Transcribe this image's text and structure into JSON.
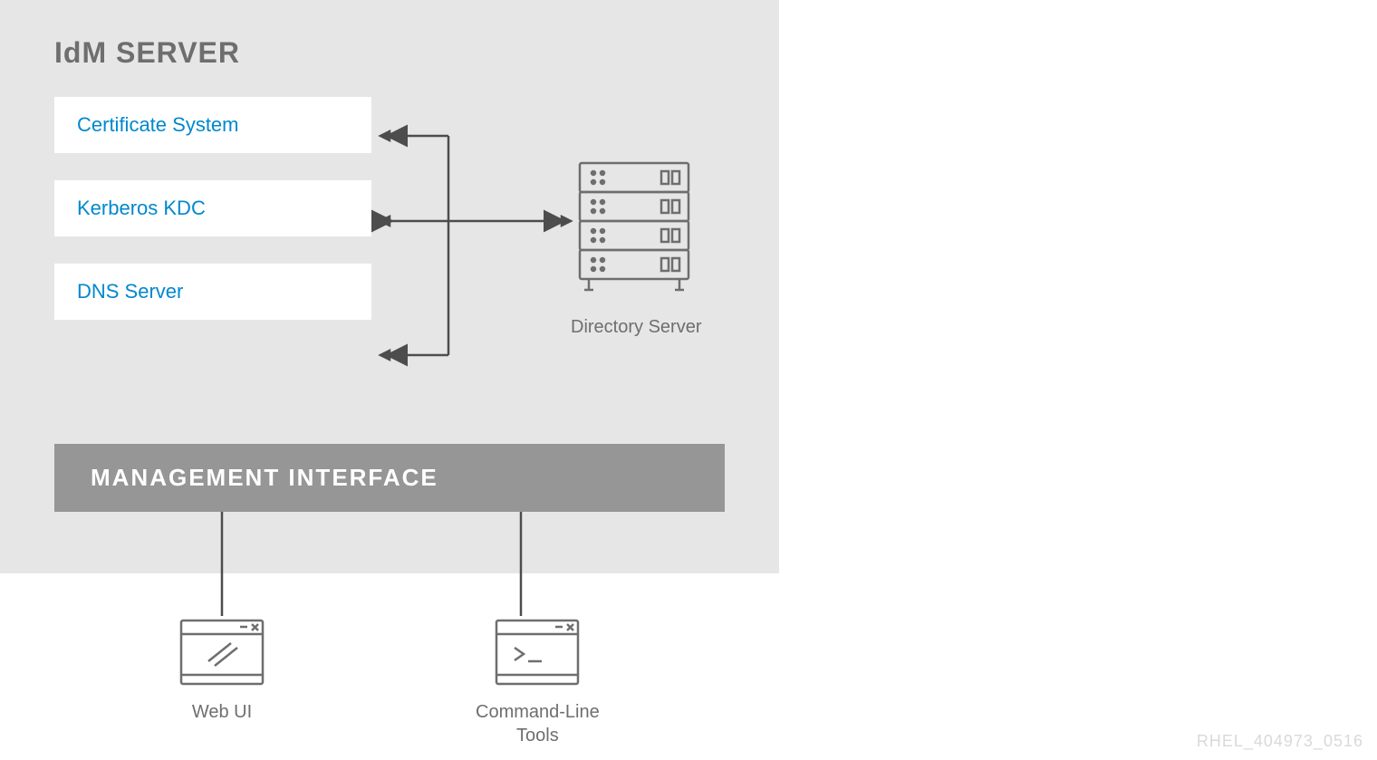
{
  "server": {
    "title": "IdM SERVER",
    "services": [
      {
        "label": "Certificate System"
      },
      {
        "label": "Kerberos KDC"
      },
      {
        "label": "DNS Server"
      }
    ],
    "directory_label": "Directory Server",
    "management_label": "MANAGEMENT INTERFACE"
  },
  "clients": {
    "webui_label": "Web UI",
    "cli_label": "Command-Line\nTools"
  },
  "watermark": "RHEL_404973_0516"
}
